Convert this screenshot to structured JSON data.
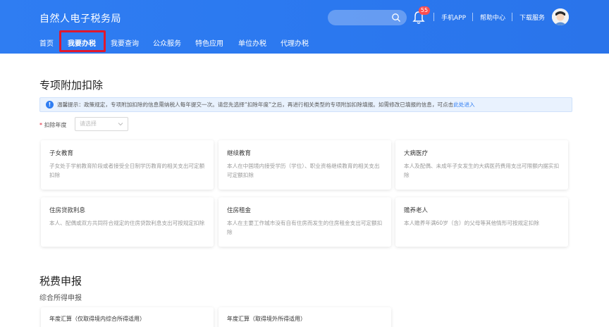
{
  "header": {
    "brand": "自然人电子税务局",
    "notification_count": "55",
    "links": [
      "手机APP",
      "帮助中心",
      "下载服务"
    ]
  },
  "nav": {
    "items": [
      "首页",
      "我要办税",
      "我要查询",
      "公众服务",
      "特色应用",
      "单位办税",
      "代理办税"
    ],
    "active": "我要办税"
  },
  "special_deduction": {
    "title": "专项附加扣除",
    "notice_text": "温馨提示：政策规定，专项附加扣除的信息需纳税人每年提交一次。请您先选择“扣除年度”之后，再进行相关类型的专项附加扣除填报。如需修改已填报的信息，可点击",
    "notice_link": "此处进入",
    "year_label": "扣除年度",
    "year_placeholder": "请选择",
    "cards": [
      {
        "title": "子女教育",
        "desc": "子女处于学前教育阶段或者接受全日制学历教育的相关支出可定额扣除"
      },
      {
        "title": "继续教育",
        "desc": "本人在中国境内接受学历（学位）、职业资格继续教育的相关支出可定额扣除"
      },
      {
        "title": "大病医疗",
        "desc": "本人及配偶、未成年子女发生的大病医药费用支出可限额内据实扣除"
      },
      {
        "title": "住房贷款利息",
        "desc": "本人、配偶或双方共同符合规定的住房贷款利息支出可按规定扣除"
      },
      {
        "title": "住房租金",
        "desc": "本人在主要工作城市没有自有住房而发生的住房租金支出可定额扣除"
      },
      {
        "title": "赡养老人",
        "desc": "本人赡养年满60岁（含）的父母等其他情形可按规定扣除"
      }
    ]
  },
  "tax_filing": {
    "title": "税费申报",
    "subtitle": "综合所得申报",
    "cards": [
      {
        "title": "年度汇算（仅取得境内综合所得适用）"
      },
      {
        "title": "年度汇算（取得境外所得适用）"
      }
    ]
  }
}
